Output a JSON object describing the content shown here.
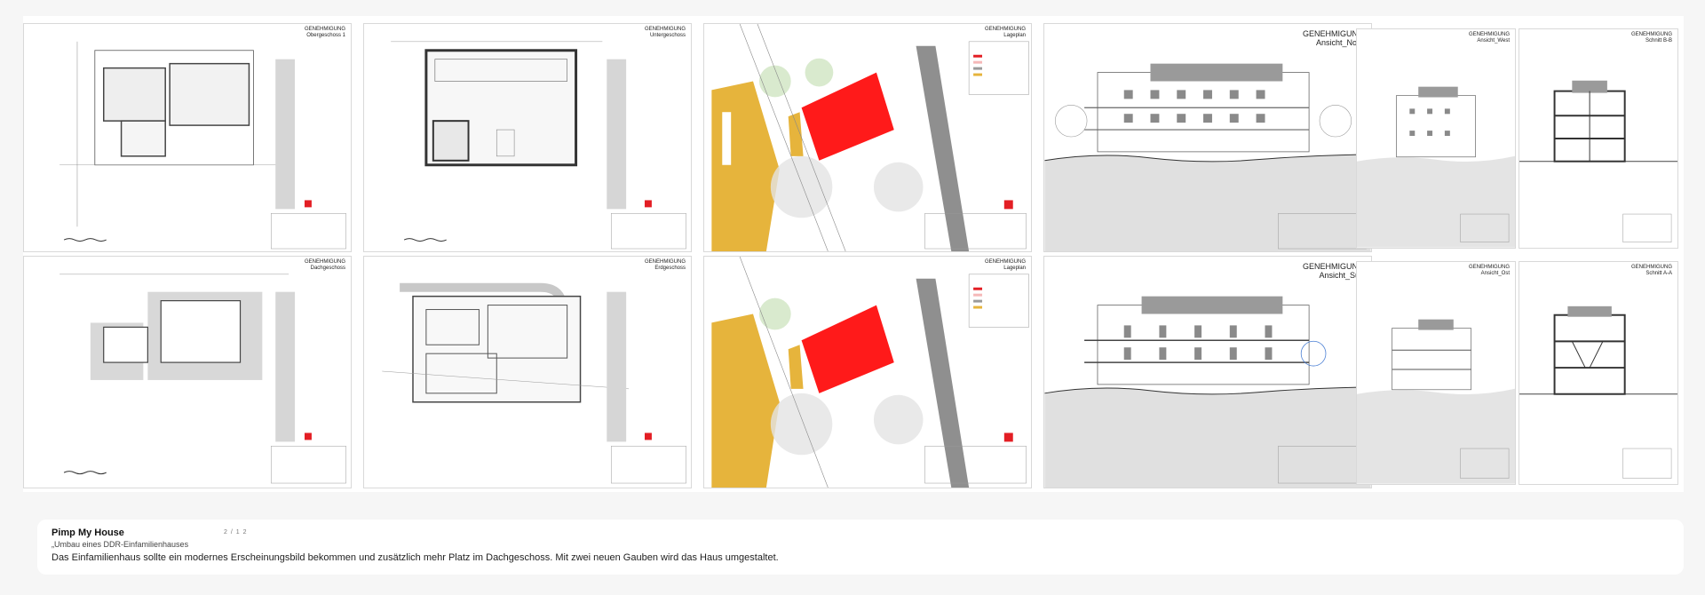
{
  "sheets": [
    {
      "id": "og1",
      "title": "GENEHMIGUNG\nObergeschoss 1",
      "type": "plan"
    },
    {
      "id": "ug",
      "title": "GENEHMIGUNG\nUntergeschoss",
      "type": "plan"
    },
    {
      "id": "lage1",
      "title": "GENEHMIGUNG\nLageplan",
      "type": "site"
    },
    {
      "id": "nord",
      "title": "GENEHMIGUNG\nAnsicht_Nord",
      "type": "elevation"
    },
    {
      "id": "west",
      "title": "GENEHMIGUNG\nAnsicht_West",
      "type": "elevation-small"
    },
    {
      "id": "schnitt1",
      "title": "GENEHMIGUNG\nSchnitt B-B",
      "type": "section"
    },
    {
      "id": "dg",
      "title": "GENEHMIGUNG\nDachgeschoss",
      "type": "plan"
    },
    {
      "id": "eg",
      "title": "GENEHMIGUNG\nErdgeschoss",
      "type": "plan"
    },
    {
      "id": "lage2",
      "title": "GENEHMIGUNG\nLageplan",
      "type": "site"
    },
    {
      "id": "sued",
      "title": "GENEHMIGUNG\nAnsicht_Süd",
      "type": "elevation"
    },
    {
      "id": "ost",
      "title": "GENEHMIGUNG\nAnsicht_Ost",
      "type": "elevation-small"
    },
    {
      "id": "schnitt2",
      "title": "GENEHMIGUNG\nSchnitt A-A",
      "type": "section"
    }
  ],
  "project": {
    "title": "Pimp My House",
    "counter": "2 / 1 2",
    "subtitle": "„Umbau eines DDR-Einfamilienhauses",
    "description": "Das Einfamilienhaus sollte ein modernes Erscheinungsbild bekommen und zusätzlich mehr Platz im Dachgeschoss. Mit zwei neuen Gauben wird das Haus umgestaltet."
  },
  "colors": {
    "accent": "#e31e24",
    "highlight": "#ff1a1a",
    "ochre": "#e6b43c",
    "green": "#b7d7a8",
    "grey": "#9a9a9a"
  }
}
